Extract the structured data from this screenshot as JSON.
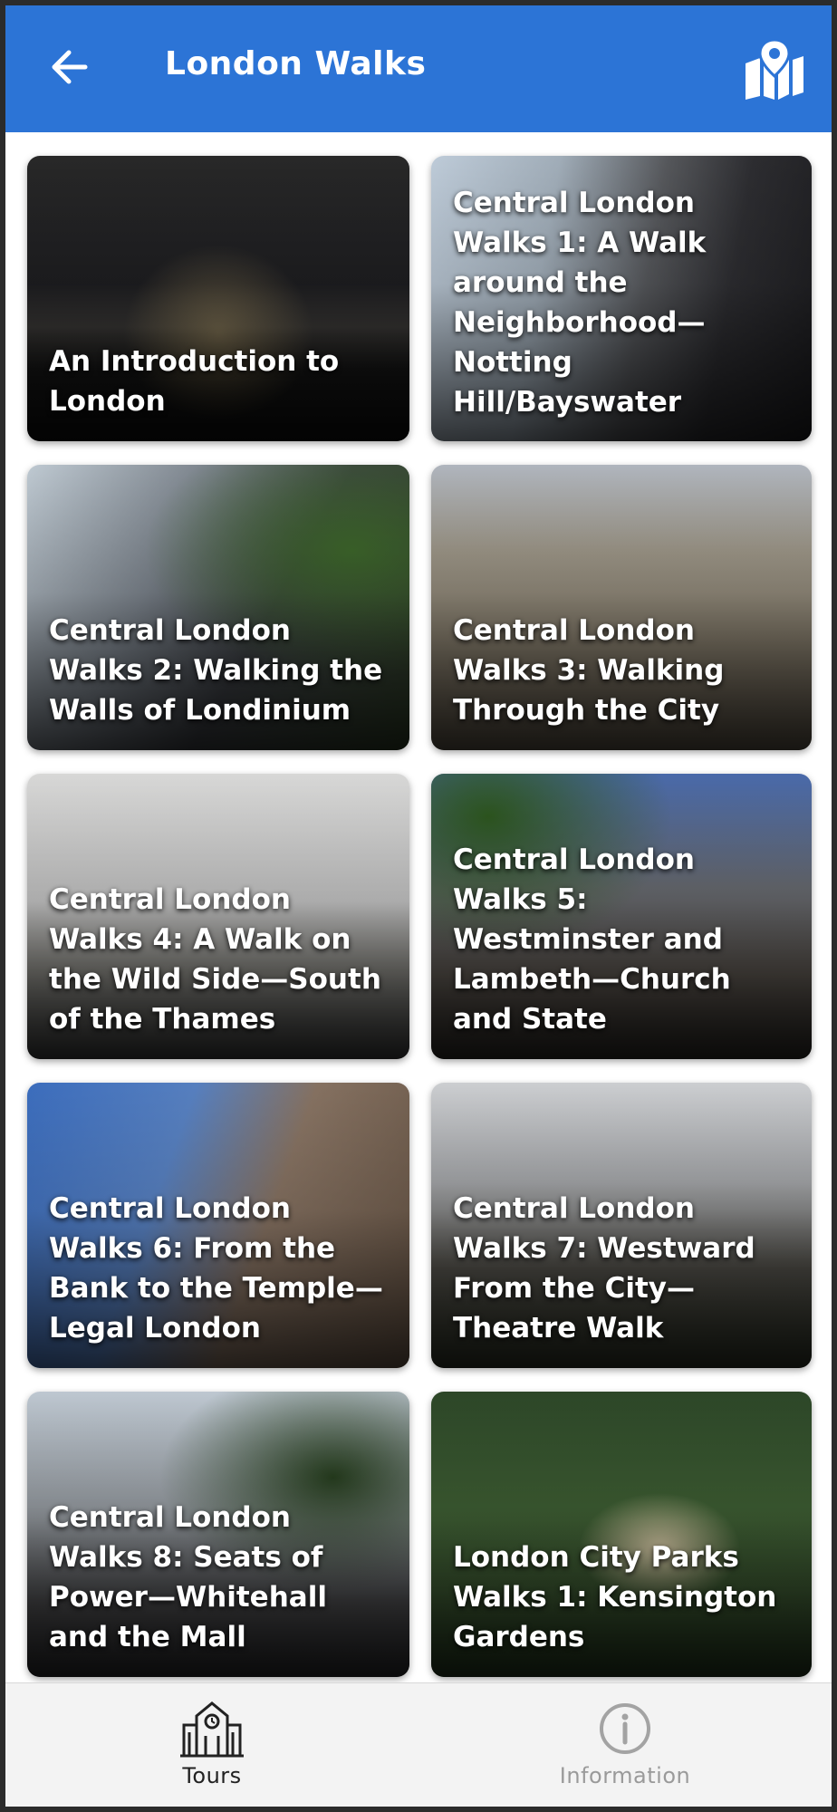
{
  "appbar": {
    "title": "London Walks",
    "back_icon": "arrow-left-icon",
    "map_icon": "map-pin-icon",
    "color": "#2c74d6"
  },
  "tours": [
    {
      "title": "An Introduction to London"
    },
    {
      "title": "Central London Walks 1: A Walk around the Neighborhood—Notting Hill/Bayswater"
    },
    {
      "title": "Central London Walks 2: Walking the Walls of Londinium"
    },
    {
      "title": "Central London Walks 3: Walking Through the City"
    },
    {
      "title": "Central London Walks 4: A Walk on the Wild Side—South of the Thames"
    },
    {
      "title": "Central London Walks 5: Westminster and Lambeth—Church and State"
    },
    {
      "title": "Central London Walks 6: From the Bank to the Temple—Legal London"
    },
    {
      "title": "Central London Walks 7: Westward From the City—Theatre Walk"
    },
    {
      "title": "Central London Walks 8: Seats of Power—Whitehall and the Mall"
    },
    {
      "title": "London City Parks Walks 1: Kensington Gardens"
    }
  ],
  "bottom_nav": {
    "tours": {
      "label": "Tours",
      "icon": "building-clock-icon",
      "active": true
    },
    "information": {
      "label": "Information",
      "icon": "info-circle-icon",
      "active": false
    }
  }
}
